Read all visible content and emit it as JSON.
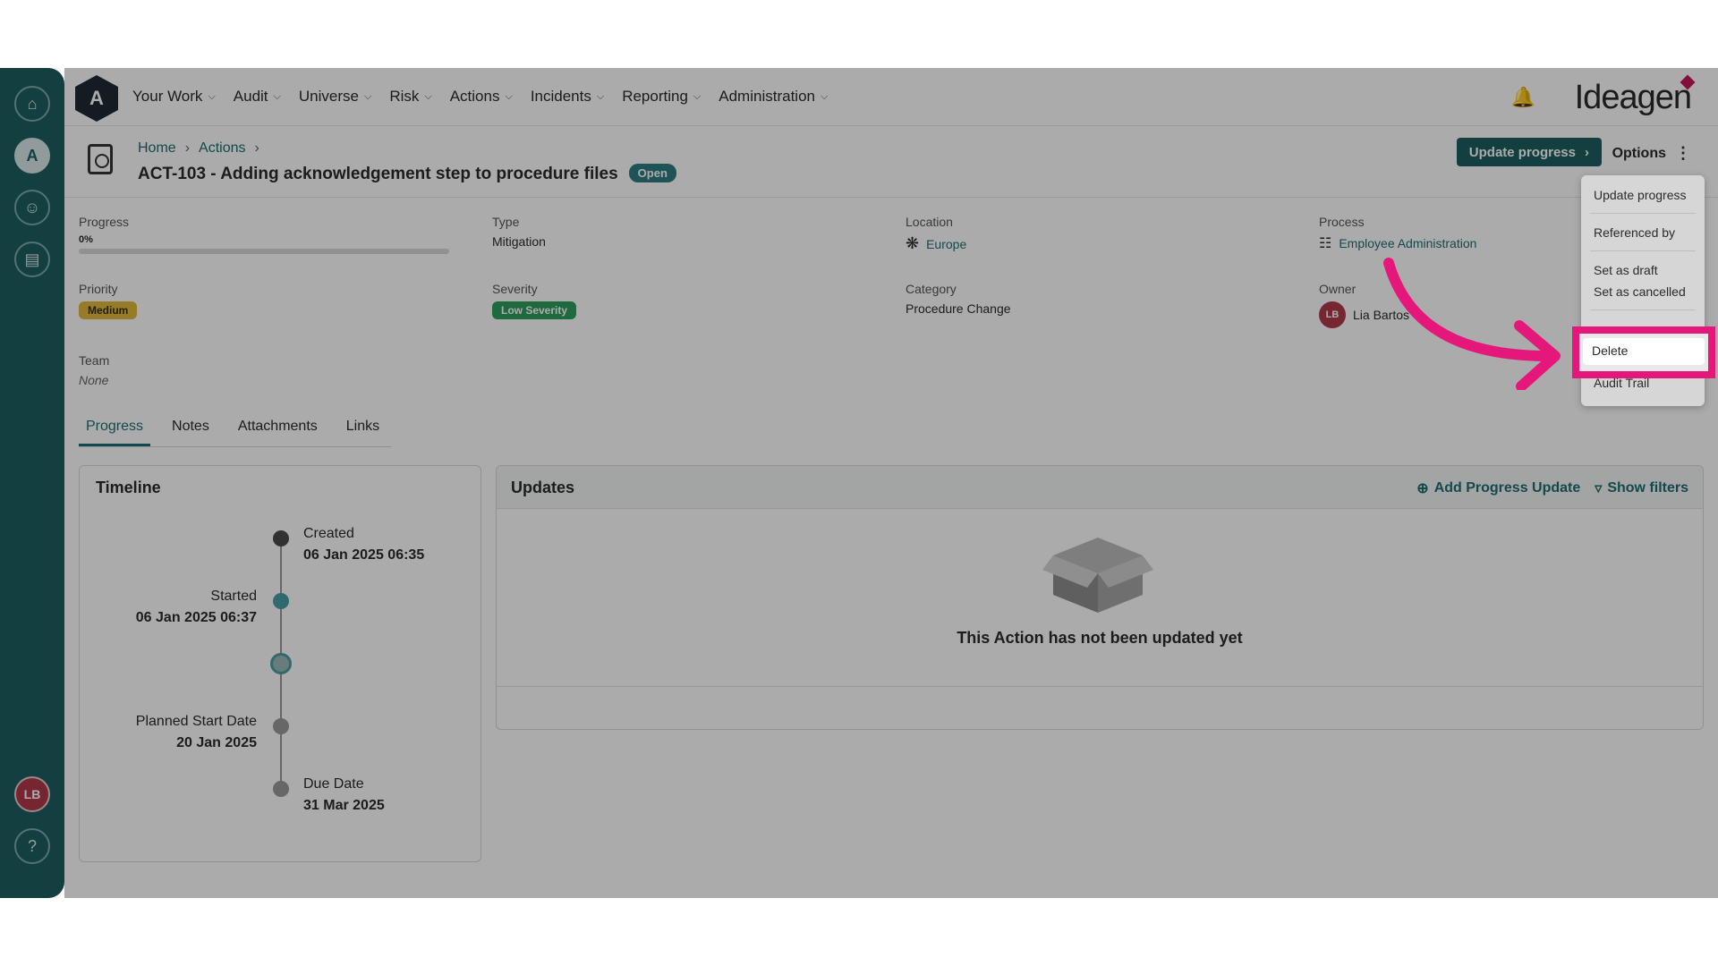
{
  "nav": {
    "logo_letter": "A",
    "items": [
      {
        "label": "Your Work"
      },
      {
        "label": "Audit"
      },
      {
        "label": "Universe"
      },
      {
        "label": "Risk"
      },
      {
        "label": "Actions"
      },
      {
        "label": "Incidents"
      },
      {
        "label": "Reporting"
      },
      {
        "label": "Administration"
      }
    ],
    "brand": "Ideagen"
  },
  "rail": {
    "avatar_initials": "LB",
    "help_label": "?"
  },
  "header": {
    "breadcrumb": [
      "Home",
      "Actions"
    ],
    "title": "ACT-103 - Adding acknowledgement step to procedure files",
    "status": "Open",
    "update_button": "Update progress",
    "options_button": "Options"
  },
  "fields": {
    "progress": {
      "label": "Progress",
      "value": "0%",
      "fraction": 0.0
    },
    "type": {
      "label": "Type",
      "value": "Mitigation"
    },
    "location": {
      "label": "Location",
      "value": "Europe"
    },
    "process": {
      "label": "Process",
      "value": "Employee Administration"
    },
    "priority": {
      "label": "Priority",
      "value": "Medium"
    },
    "severity": {
      "label": "Severity",
      "value": "Low Severity"
    },
    "category": {
      "label": "Category",
      "value": "Procedure Change"
    },
    "owner": {
      "label": "Owner",
      "initials": "LB",
      "name": "Lia Bartos"
    },
    "team": {
      "label": "Team",
      "value": "None"
    }
  },
  "tabs": [
    {
      "label": "Progress",
      "active": true
    },
    {
      "label": "Notes"
    },
    {
      "label": "Attachments"
    },
    {
      "label": "Links"
    }
  ],
  "timeline": {
    "title": "Timeline",
    "events": [
      {
        "label": "Created",
        "date": "06 Jan 2025 06:35"
      },
      {
        "label": "Started",
        "date": "06 Jan 2025 06:37"
      },
      {
        "label": "Planned Start Date",
        "date": "20 Jan 2025"
      },
      {
        "label": "Due Date",
        "date": "31 Mar 2025"
      }
    ]
  },
  "updates": {
    "title": "Updates",
    "add_label": "Add Progress Update",
    "filter_label": "Show filters",
    "empty_message": "This Action has not been updated yet"
  },
  "options_menu": {
    "items": [
      "Update progress",
      "Referenced by",
      "Set as draft",
      "Set as cancelled",
      "Delete",
      "Audit Trail"
    ],
    "highlighted": "Delete"
  },
  "colors": {
    "brand": "#1e5f62",
    "highlight": "#e5177b"
  }
}
